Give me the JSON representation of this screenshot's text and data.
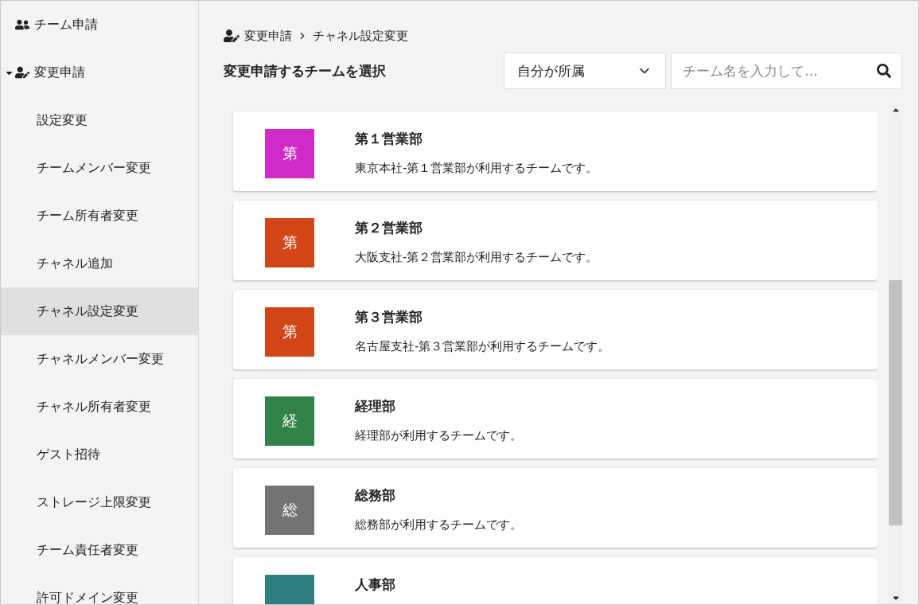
{
  "sidebar": {
    "items": [
      {
        "label": "チーム申請",
        "selected": false
      },
      {
        "label": "変更申請",
        "expanded": true,
        "selected": false,
        "children": [
          {
            "label": "設定変更",
            "selected": false
          },
          {
            "label": "チームメンバー変更",
            "selected": false
          },
          {
            "label": "チーム所有者変更",
            "selected": false
          },
          {
            "label": "チャネル追加",
            "selected": false
          },
          {
            "label": "チャネル設定変更",
            "selected": true
          },
          {
            "label": "チャネルメンバー変更",
            "selected": false
          },
          {
            "label": "チャネル所有者変更",
            "selected": false
          },
          {
            "label": "ゲスト招待",
            "selected": false
          },
          {
            "label": "ストレージ上限変更",
            "selected": false
          },
          {
            "label": "チーム責任者変更",
            "selected": false
          },
          {
            "label": "許可ドメイン変更",
            "selected": false
          }
        ]
      }
    ]
  },
  "breadcrumb": [
    "変更申請",
    "チャネル設定変更"
  ],
  "heading": "変更申請するチームを選択",
  "filter": {
    "value": "自分が所属"
  },
  "search": {
    "placeholder": "チーム名を入力して…"
  },
  "teams": [
    {
      "avatar": "第",
      "color": "#d02bc8",
      "name": "第１営業部",
      "description": "東京本社-第１営業部が利用するチームです。"
    },
    {
      "avatar": "第",
      "color": "#d24516",
      "name": "第２営業部",
      "description": "大阪支社-第２営業部が利用するチームです。"
    },
    {
      "avatar": "第",
      "color": "#d24516",
      "name": "第３営業部",
      "description": "名古屋支社-第３営業部が利用するチームです。"
    },
    {
      "avatar": "経",
      "color": "#31834a",
      "name": "経理部",
      "description": "経理部が利用するチームです。"
    },
    {
      "avatar": "総",
      "color": "#747474",
      "name": "総務部",
      "description": "総務部が利用するチームです。"
    },
    {
      "color": "#307f80",
      "name": "人事部"
    }
  ]
}
